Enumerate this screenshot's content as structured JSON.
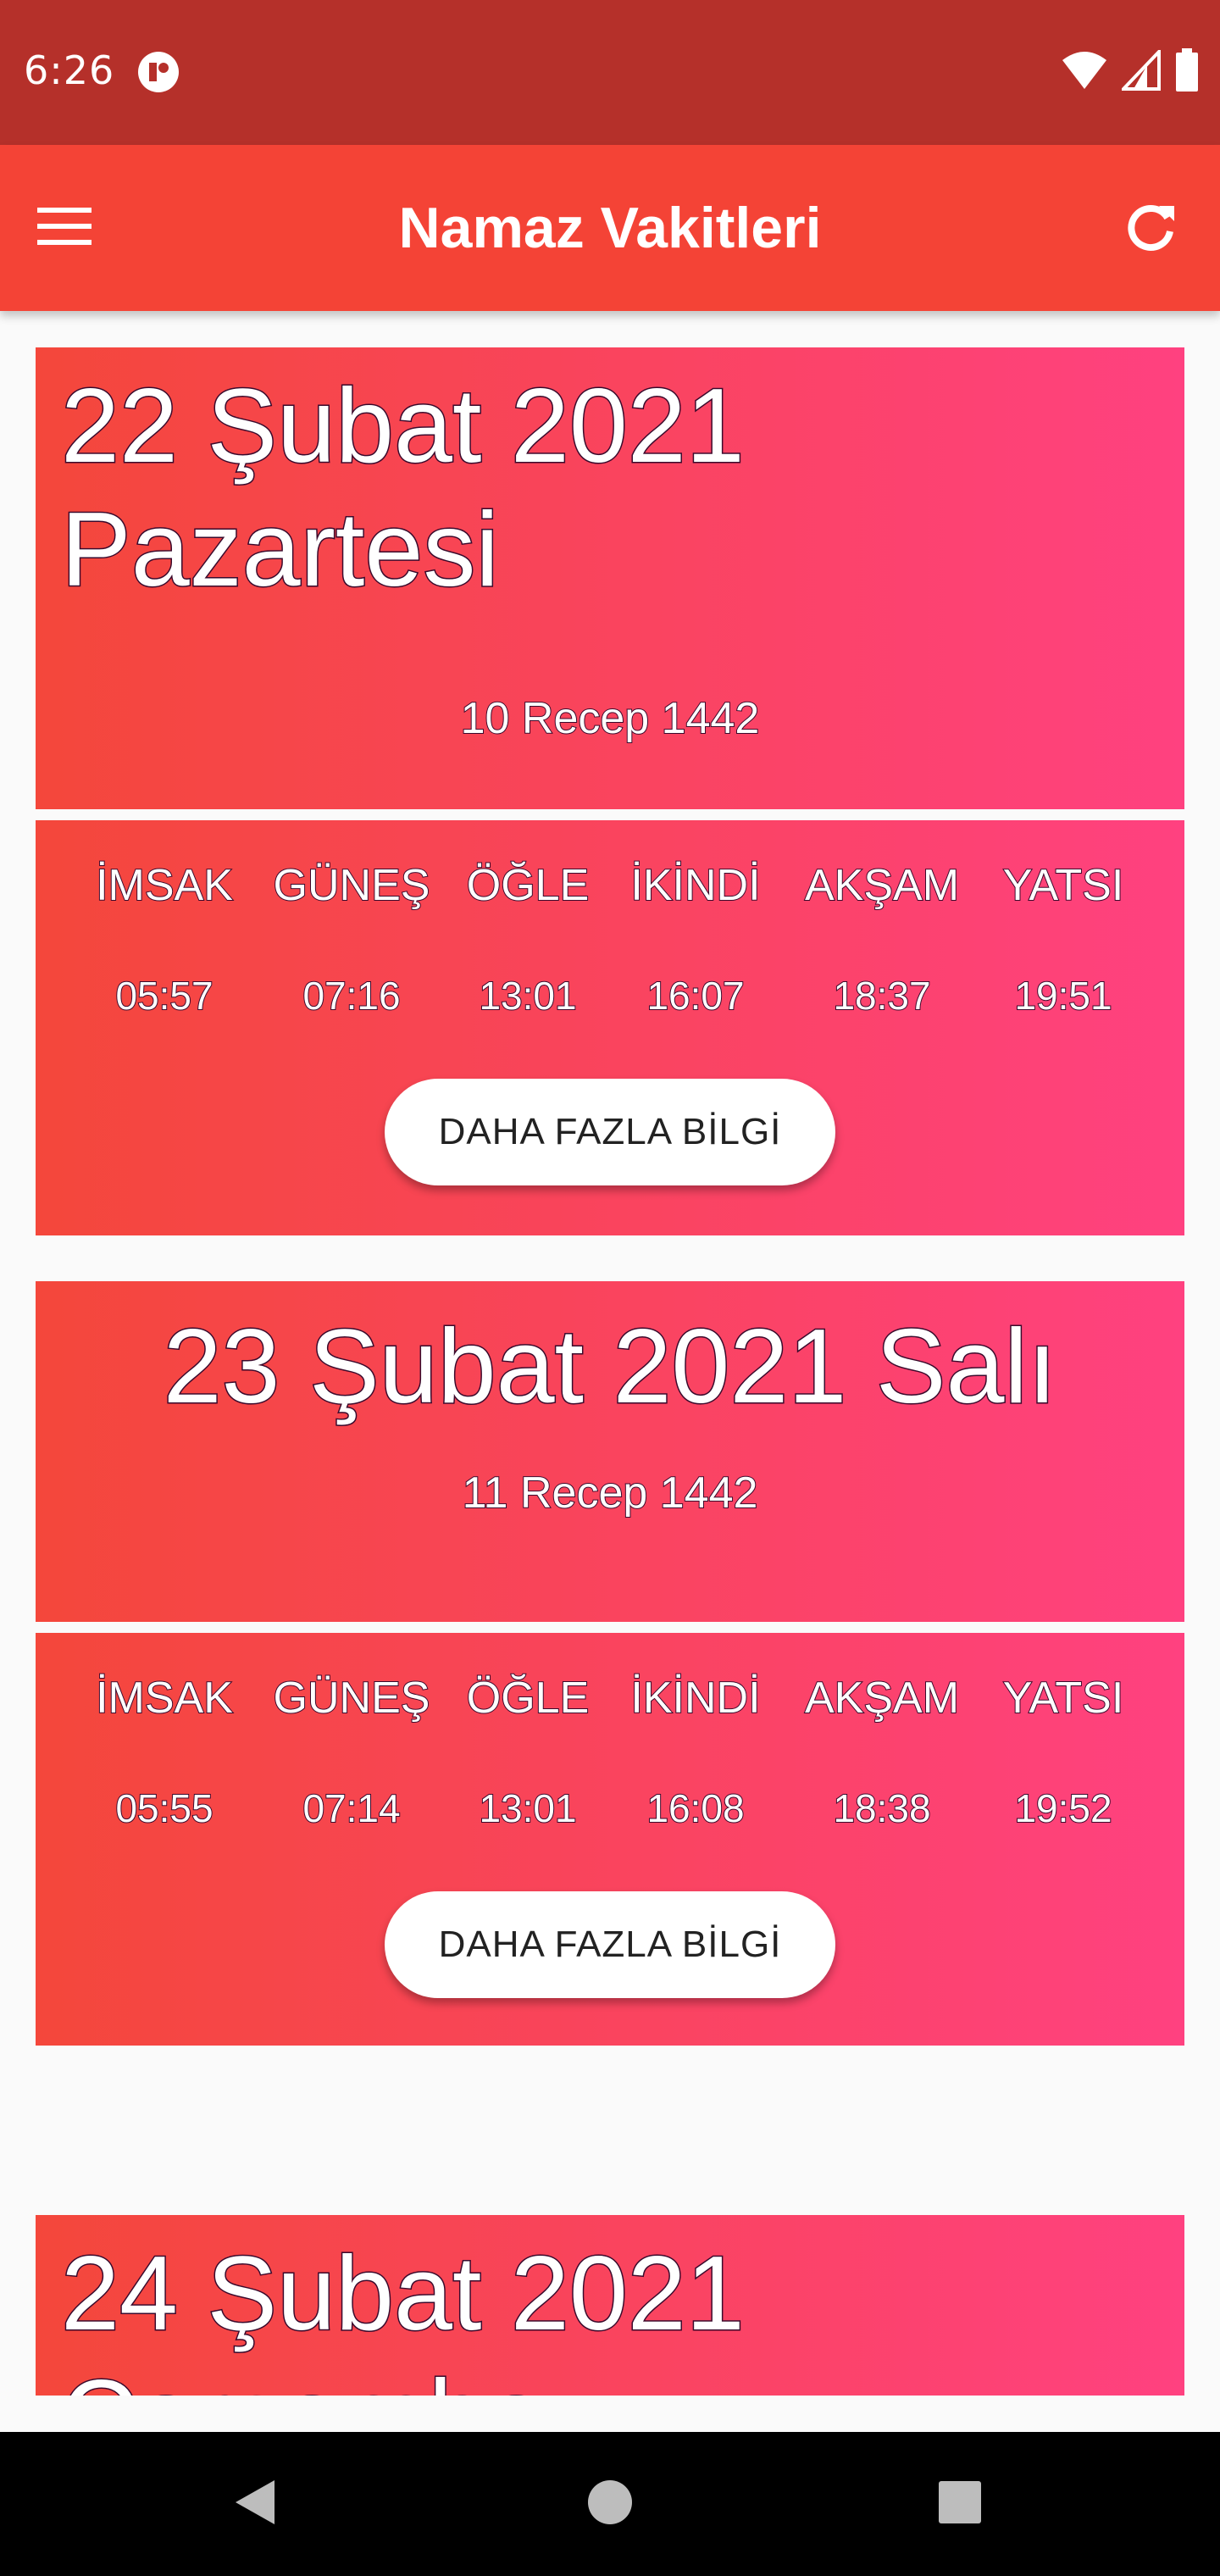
{
  "status_bar": {
    "time": "6:26",
    "icons": [
      "app-notification-icon",
      "wifi-icon",
      "cell-signal-icon",
      "battery-icon"
    ]
  },
  "app_bar": {
    "title": "Namaz Vakitleri",
    "menu_icon": "hamburger-menu-icon",
    "refresh_icon": "refresh-icon"
  },
  "prayer_names": [
    "İMSAK",
    "GÜNEŞ",
    "ÖĞLE",
    "İKİNDİ",
    "AKŞAM",
    "YATSI"
  ],
  "more_button_label": "DAHA FAZLA BİLGİ",
  "days": [
    {
      "date_line1": "22 Şubat 2021",
      "date_line2": "Pazartesi",
      "hijri": "10 Recep 1442",
      "times": [
        "05:57",
        "07:16",
        "13:01",
        "16:07",
        "18:37",
        "19:51"
      ]
    },
    {
      "date_full": "23 Şubat 2021 Salı",
      "hijri": "11 Recep 1442",
      "times": [
        "05:55",
        "07:14",
        "13:01",
        "16:08",
        "18:38",
        "19:52"
      ]
    },
    {
      "date_line1": "24 Şubat 2021",
      "date_line2": "Çarşamba"
    }
  ],
  "colors": {
    "status_bar": "#b5302a",
    "app_bar": "#f44336",
    "gradient_start": "#f4473b",
    "gradient_end": "#ff4180",
    "background": "#fafafa",
    "nav_bar": "#000000"
  },
  "nav_bar": {
    "icons": [
      "back-icon",
      "home-icon",
      "recents-icon"
    ]
  }
}
